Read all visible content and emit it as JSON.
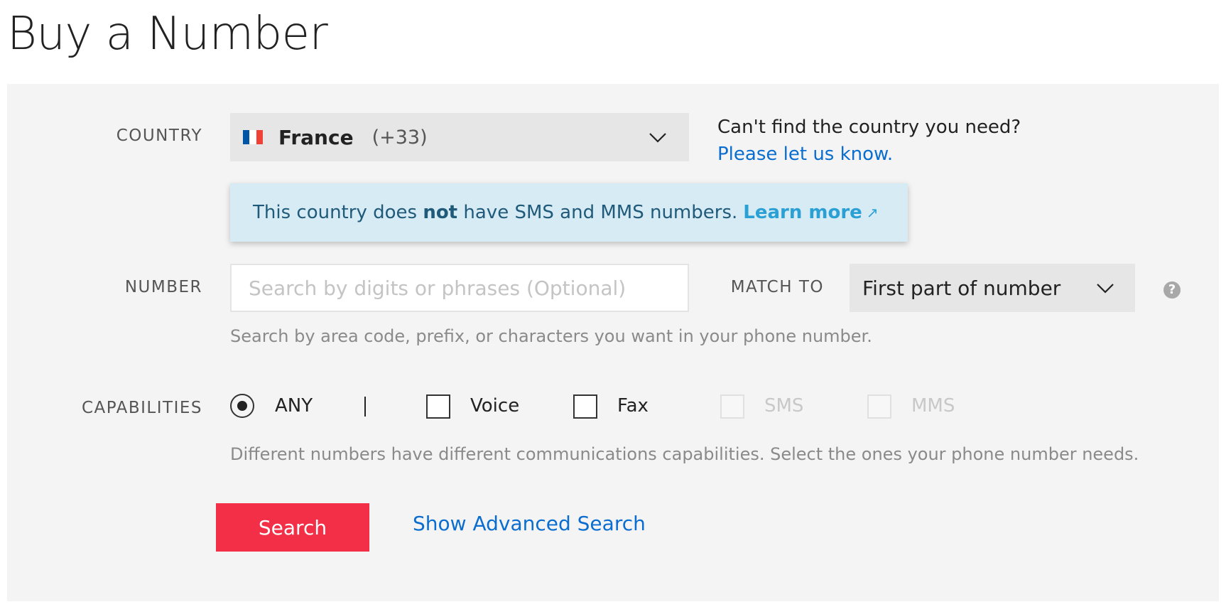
{
  "page": {
    "title": "Buy a Number"
  },
  "country": {
    "label": "COUNTRY",
    "selected_name": "France",
    "selected_code": "(+33)",
    "flag_colors": [
      "#0055a4",
      "#ffffff",
      "#ef4135"
    ],
    "help_question": "Can't find the country you need?",
    "help_link": "Please let us know."
  },
  "notice": {
    "text_before": "This country does ",
    "text_bold": "not",
    "text_after": " have SMS and MMS numbers.",
    "link": "Learn more",
    "link_icon": "external-link-icon"
  },
  "number": {
    "label": "NUMBER",
    "value": "",
    "placeholder": "Search by digits or phrases (Optional)",
    "match_label": "MATCH TO",
    "match_selected": "First part of number",
    "hint": "Search by area code, prefix, or characters you want in your phone number."
  },
  "capabilities": {
    "label": "CAPABILITIES",
    "any": {
      "label": "ANY",
      "selected": true
    },
    "options": [
      {
        "label": "Voice",
        "checked": false,
        "disabled": false
      },
      {
        "label": "Fax",
        "checked": false,
        "disabled": false
      },
      {
        "label": "SMS",
        "checked": false,
        "disabled": true
      },
      {
        "label": "MMS",
        "checked": false,
        "disabled": true
      }
    ],
    "hint": "Different numbers have different communications capabilities. Select the ones your phone number needs."
  },
  "actions": {
    "search_label": "Search",
    "advanced_label": "Show Advanced Search"
  },
  "colors": {
    "accent_red": "#f22f46",
    "link_blue": "#0a6dcf",
    "notice_bg": "#d7ebf5"
  }
}
